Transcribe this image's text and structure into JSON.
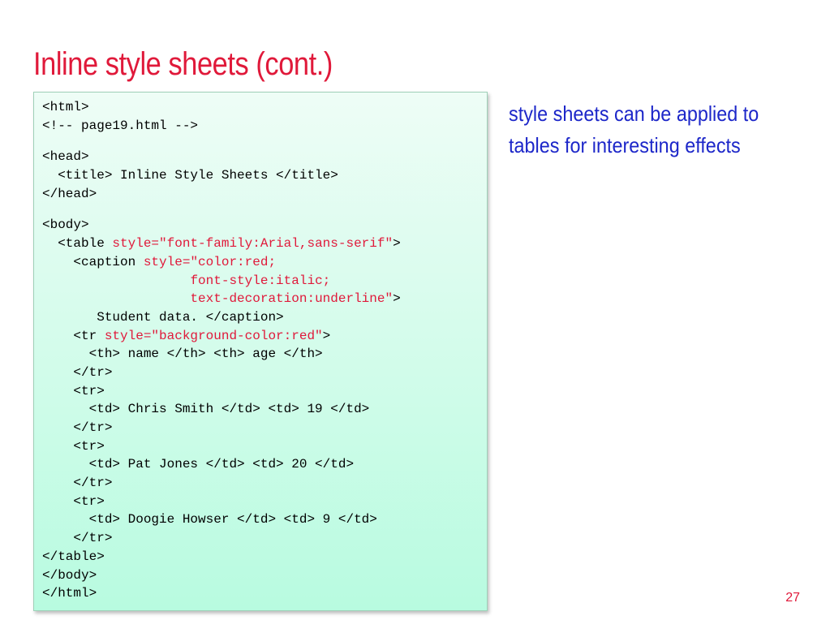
{
  "colors": {
    "title": "#e0193a",
    "attribute": "#e0193a",
    "note": "#1d27c9",
    "page_number": "#e0193a"
  },
  "slide": {
    "title": "Inline style sheets (cont.)",
    "note_lines": [
      "style sheets can be applied to",
      "tables for interesting effects"
    ],
    "page_number": "27"
  },
  "code": {
    "lines": [
      {
        "segments": [
          {
            "text": "<html>",
            "kind": "plain"
          }
        ]
      },
      {
        "segments": [
          {
            "text": "<!-- page19.html -->",
            "kind": "plain"
          }
        ]
      },
      {
        "gap": true,
        "segments": [
          {
            "text": "<head>",
            "kind": "plain"
          }
        ]
      },
      {
        "segments": [
          {
            "text": "  <title> Inline Style Sheets </title>",
            "kind": "plain"
          }
        ]
      },
      {
        "segments": [
          {
            "text": "</head>",
            "kind": "plain"
          }
        ]
      },
      {
        "gap": true,
        "segments": [
          {
            "text": "<body>",
            "kind": "plain"
          }
        ]
      },
      {
        "segments": [
          {
            "text": "  <table ",
            "kind": "plain"
          },
          {
            "text": "style=\"font-family:Arial,sans-serif\"",
            "kind": "attr"
          },
          {
            "text": ">",
            "kind": "plain"
          }
        ]
      },
      {
        "segments": [
          {
            "text": "    <caption ",
            "kind": "plain"
          },
          {
            "text": "style=\"color:red;",
            "kind": "attr"
          }
        ]
      },
      {
        "segments": [
          {
            "text": "                   ",
            "kind": "plain"
          },
          {
            "text": "font-style:italic;",
            "kind": "attr"
          }
        ]
      },
      {
        "segments": [
          {
            "text": "                   ",
            "kind": "plain"
          },
          {
            "text": "text-decoration:underline\"",
            "kind": "attr"
          },
          {
            "text": ">",
            "kind": "plain"
          }
        ]
      },
      {
        "segments": [
          {
            "text": "       Student data. </caption>",
            "kind": "plain"
          }
        ]
      },
      {
        "segments": [
          {
            "text": "    <tr ",
            "kind": "plain"
          },
          {
            "text": "style=\"background-color:red\"",
            "kind": "attr"
          },
          {
            "text": ">",
            "kind": "plain"
          }
        ]
      },
      {
        "segments": [
          {
            "text": "      <th> name </th> <th> age </th>",
            "kind": "plain"
          }
        ]
      },
      {
        "segments": [
          {
            "text": "    </tr>",
            "kind": "plain"
          }
        ]
      },
      {
        "segments": [
          {
            "text": "    <tr>",
            "kind": "plain"
          }
        ]
      },
      {
        "segments": [
          {
            "text": "      <td> Chris Smith </td> <td> 19 </td>",
            "kind": "plain"
          }
        ]
      },
      {
        "segments": [
          {
            "text": "    </tr>",
            "kind": "plain"
          }
        ]
      },
      {
        "segments": [
          {
            "text": "    <tr>",
            "kind": "plain"
          }
        ]
      },
      {
        "segments": [
          {
            "text": "      <td> Pat Jones </td> <td> 20 </td>",
            "kind": "plain"
          }
        ]
      },
      {
        "segments": [
          {
            "text": "    </tr>",
            "kind": "plain"
          }
        ]
      },
      {
        "segments": [
          {
            "text": "    <tr>",
            "kind": "plain"
          }
        ]
      },
      {
        "segments": [
          {
            "text": "      <td> Doogie Howser </td> <td> 9 </td>",
            "kind": "plain"
          }
        ]
      },
      {
        "segments": [
          {
            "text": "    </tr>",
            "kind": "plain"
          }
        ]
      },
      {
        "segments": [
          {
            "text": "</table>",
            "kind": "plain"
          }
        ]
      },
      {
        "segments": [
          {
            "text": "</body>",
            "kind": "plain"
          }
        ]
      },
      {
        "segments": [
          {
            "text": "</html>",
            "kind": "plain"
          }
        ]
      }
    ]
  }
}
